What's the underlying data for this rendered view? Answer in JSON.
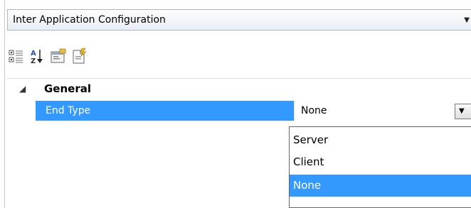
{
  "object_selector": {
    "value": "Inter Application Configuration"
  },
  "toolbar": {
    "categorized_icon": "categorized-icon",
    "alphabetical_icon": "alphabetical-sort-icon",
    "property_pages_icon": "property-pages-icon",
    "events_icon": "events-icon"
  },
  "grid": {
    "category": {
      "expander": "◢",
      "label": "General"
    },
    "property": {
      "name": "End Type",
      "value": "None"
    }
  },
  "dropdown": {
    "arrow": "▼",
    "options": [
      {
        "label": "Server",
        "selected": false
      },
      {
        "label": "Client",
        "selected": false
      },
      {
        "label": "None",
        "selected": true
      }
    ]
  },
  "colors": {
    "selection": "#3399ff",
    "border": "#a9b7c6"
  }
}
